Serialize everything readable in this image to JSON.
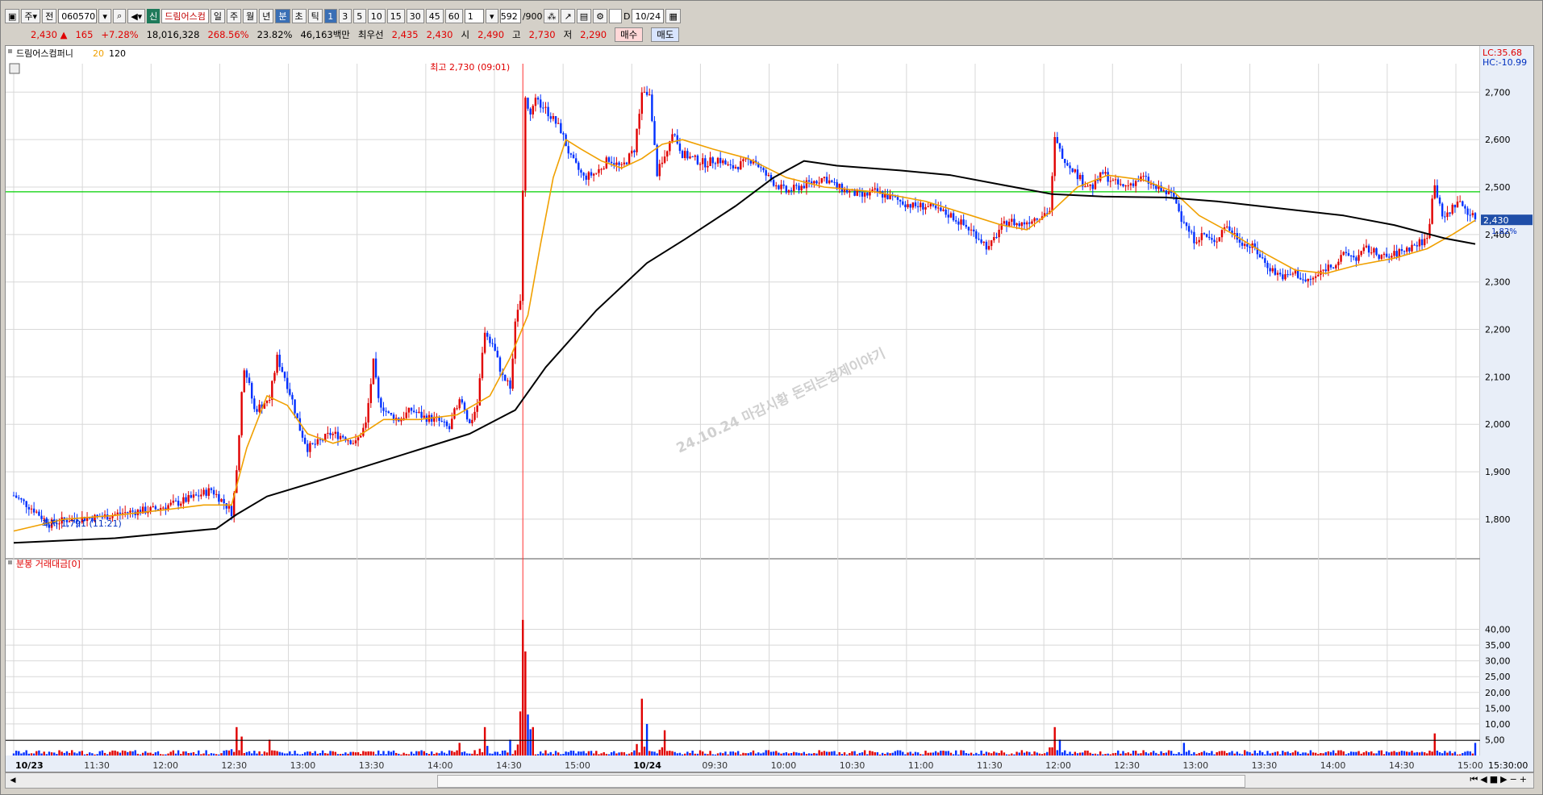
{
  "toolbar": {
    "market": "주",
    "prefix": "전",
    "code": "060570",
    "credit_tag": "신",
    "name": "드림어스컴",
    "periods": [
      "일",
      "주",
      "월",
      "년",
      "분",
      "초",
      "틱"
    ],
    "active_period": "분",
    "intervals": [
      "1",
      "3",
      "5",
      "10",
      "15",
      "30",
      "45",
      "60"
    ],
    "active_interval": "1",
    "unit": "1",
    "count": "592",
    "count_total": "/900",
    "d_label": "D",
    "date": "10/24"
  },
  "quote": {
    "price": "2,430",
    "arrow": "▲",
    "change": "165",
    "change_pct": "+7.28%",
    "volume": "18,016,328",
    "vol_ratio": "268.56%",
    "turnover": "23.82%",
    "amount": "46,163백만",
    "best_label": "최우선",
    "best_ask": "2,435",
    "best_bid": "2,430",
    "open_label": "시",
    "open": "2,490",
    "high_label": "고",
    "high": "2,730",
    "low_label": "저",
    "low": "2,290",
    "buy_label": "매수",
    "sell_label": "매도"
  },
  "legend": {
    "name": "드림어스컴퍼니",
    "ma1": "20",
    "ma2": "120",
    "lc": "LC:35.68",
    "hc": "HC:-10.99",
    "price_tag": "2,430",
    "pct_tag": "1.82%",
    "volume_title": "분봉 거래대금[0]",
    "high_note": "최고 2,730 (09:01)",
    "low_note": "최저 1,791 (11:21)",
    "watermark": "24.10.24 마감시황 돈되는경제이야기",
    "end_time": "15:30:00"
  },
  "colors": {
    "up": "#e00000",
    "down": "#0030ff",
    "ma20": "#f0a000",
    "ma120": "#000000",
    "hline": "#00d000",
    "grid": "#d8d8d8"
  },
  "chart_data": [
    {
      "type": "candlestick",
      "title": "드림어스컴퍼니",
      "ylim": [
        1720,
        2760
      ],
      "yticks": [
        1800,
        1900,
        2000,
        2100,
        2200,
        2300,
        2400,
        2500,
        2600,
        2700
      ],
      "ytick_labels": [
        "1,800",
        "1,900",
        "2,000",
        "2,100",
        "2,200",
        "2,300",
        "2,400",
        "2,500",
        "2,600",
        "2,700"
      ],
      "horizontal_line": 2490,
      "x_labels": [
        "10/23",
        "11:30",
        "12:00",
        "12:30",
        "13:00",
        "13:30",
        "14:00",
        "14:30",
        "15:00",
        "10/24",
        "09:30",
        "10:00",
        "10:30",
        "11:00",
        "11:30",
        "12:00",
        "12:30",
        "13:00",
        "13:30",
        "14:00",
        "14:30",
        "15:00"
      ],
      "price_path": [
        [
          0,
          1850
        ],
        [
          8,
          1820
        ],
        [
          14,
          1790
        ],
        [
          22,
          1800
        ],
        [
          35,
          1805
        ],
        [
          45,
          1815
        ],
        [
          55,
          1820
        ],
        [
          65,
          1835
        ],
        [
          72,
          1848
        ],
        [
          78,
          1862
        ],
        [
          83,
          1835
        ],
        [
          86,
          1815
        ],
        [
          88,
          1900
        ],
        [
          90,
          2060
        ],
        [
          91,
          2120
        ],
        [
          93,
          2080
        ],
        [
          95,
          2030
        ],
        [
          98,
          2040
        ],
        [
          101,
          2060
        ],
        [
          104,
          2140
        ],
        [
          107,
          2100
        ],
        [
          110,
          2050
        ],
        [
          113,
          1990
        ],
        [
          116,
          1950
        ],
        [
          120,
          1960
        ],
        [
          125,
          1980
        ],
        [
          130,
          1975
        ],
        [
          135,
          1960
        ],
        [
          139,
          2000
        ],
        [
          142,
          2130
        ],
        [
          144,
          2050
        ],
        [
          148,
          2020
        ],
        [
          152,
          2010
        ],
        [
          157,
          2030
        ],
        [
          162,
          2015
        ],
        [
          167,
          2010
        ],
        [
          172,
          1990
        ],
        [
          176,
          2060
        ],
        [
          180,
          2000
        ],
        [
          183,
          2040
        ],
        [
          186,
          2200
        ],
        [
          189,
          2170
        ],
        [
          193,
          2100
        ],
        [
          196,
          2080
        ],
        [
          198,
          2210
        ],
        [
          200,
          2260
        ],
        [
          201,
          2500
        ],
        [
          202,
          2680
        ],
        [
          204,
          2650
        ],
        [
          206,
          2680
        ],
        [
          209,
          2670
        ],
        [
          212,
          2650
        ],
        [
          216,
          2620
        ],
        [
          220,
          2560
        ],
        [
          225,
          2520
        ],
        [
          230,
          2530
        ],
        [
          235,
          2560
        ],
        [
          240,
          2540
        ],
        [
          245,
          2580
        ],
        [
          248,
          2700
        ],
        [
          251,
          2690
        ],
        [
          254,
          2530
        ],
        [
          257,
          2560
        ],
        [
          260,
          2620
        ],
        [
          264,
          2570
        ],
        [
          268,
          2560
        ],
        [
          273,
          2550
        ],
        [
          278,
          2560
        ],
        [
          283,
          2540
        ],
        [
          288,
          2550
        ],
        [
          292,
          2560
        ],
        [
          296,
          2530
        ],
        [
          300,
          2510
        ],
        [
          305,
          2490
        ],
        [
          310,
          2500
        ],
        [
          315,
          2510
        ],
        [
          320,
          2520
        ],
        [
          325,
          2500
        ],
        [
          330,
          2490
        ],
        [
          335,
          2480
        ],
        [
          340,
          2490
        ],
        [
          345,
          2480
        ],
        [
          350,
          2470
        ],
        [
          355,
          2460
        ],
        [
          360,
          2460
        ],
        [
          365,
          2450
        ],
        [
          370,
          2440
        ],
        [
          375,
          2420
        ],
        [
          380,
          2400
        ],
        [
          385,
          2370
        ],
        [
          389,
          2410
        ],
        [
          393,
          2430
        ],
        [
          397,
          2420
        ],
        [
          401,
          2430
        ],
        [
          405,
          2440
        ],
        [
          409,
          2450
        ],
        [
          411,
          2600
        ],
        [
          414,
          2560
        ],
        [
          418,
          2540
        ],
        [
          422,
          2510
        ],
        [
          426,
          2500
        ],
        [
          430,
          2530
        ],
        [
          434,
          2510
        ],
        [
          438,
          2500
        ],
        [
          442,
          2510
        ],
        [
          446,
          2520
        ],
        [
          450,
          2500
        ],
        [
          454,
          2490
        ],
        [
          458,
          2480
        ],
        [
          462,
          2420
        ],
        [
          466,
          2390
        ],
        [
          470,
          2400
        ],
        [
          474,
          2380
        ],
        [
          478,
          2420
        ],
        [
          482,
          2400
        ],
        [
          486,
          2380
        ],
        [
          490,
          2370
        ],
        [
          494,
          2340
        ],
        [
          498,
          2320
        ],
        [
          502,
          2310
        ],
        [
          506,
          2320
        ],
        [
          510,
          2300
        ],
        [
          514,
          2310
        ],
        [
          518,
          2330
        ],
        [
          522,
          2340
        ],
        [
          526,
          2360
        ],
        [
          530,
          2350
        ],
        [
          534,
          2370
        ],
        [
          538,
          2360
        ],
        [
          542,
          2350
        ],
        [
          546,
          2360
        ],
        [
          550,
          2370
        ],
        [
          554,
          2380
        ],
        [
          558,
          2390
        ],
        [
          561,
          2510
        ],
        [
          564,
          2430
        ],
        [
          567,
          2450
        ],
        [
          570,
          2470
        ],
        [
          574,
          2450
        ],
        [
          577,
          2430
        ]
      ],
      "ma20_path": [
        [
          0,
          1775
        ],
        [
          20,
          1800
        ],
        [
          40,
          1808
        ],
        [
          60,
          1820
        ],
        [
          75,
          1830
        ],
        [
          86,
          1830
        ],
        [
          92,
          1950
        ],
        [
          100,
          2060
        ],
        [
          108,
          2040
        ],
        [
          116,
          1980
        ],
        [
          126,
          1960
        ],
        [
          136,
          1975
        ],
        [
          146,
          2010
        ],
        [
          160,
          2010
        ],
        [
          175,
          2020
        ],
        [
          188,
          2060
        ],
        [
          196,
          2140
        ],
        [
          203,
          2230
        ],
        [
          208,
          2380
        ],
        [
          213,
          2520
        ],
        [
          218,
          2600
        ],
        [
          224,
          2580
        ],
        [
          232,
          2555
        ],
        [
          240,
          2540
        ],
        [
          248,
          2560
        ],
        [
          256,
          2590
        ],
        [
          264,
          2600
        ],
        [
          276,
          2580
        ],
        [
          290,
          2560
        ],
        [
          305,
          2520
        ],
        [
          320,
          2500
        ],
        [
          340,
          2490
        ],
        [
          360,
          2470
        ],
        [
          378,
          2440
        ],
        [
          390,
          2420
        ],
        [
          400,
          2410
        ],
        [
          410,
          2450
        ],
        [
          420,
          2500
        ],
        [
          432,
          2525
        ],
        [
          446,
          2515
        ],
        [
          458,
          2490
        ],
        [
          468,
          2440
        ],
        [
          480,
          2405
        ],
        [
          494,
          2360
        ],
        [
          506,
          2325
        ],
        [
          518,
          2318
        ],
        [
          530,
          2335
        ],
        [
          545,
          2350
        ],
        [
          558,
          2370
        ],
        [
          568,
          2400
        ],
        [
          577,
          2430
        ]
      ],
      "ma120_path": [
        [
          0,
          1750
        ],
        [
          40,
          1760
        ],
        [
          80,
          1780
        ],
        [
          88,
          1810
        ],
        [
          100,
          1848
        ],
        [
          120,
          1880
        ],
        [
          150,
          1930
        ],
        [
          180,
          1980
        ],
        [
          198,
          2030
        ],
        [
          210,
          2120
        ],
        [
          230,
          2240
        ],
        [
          250,
          2340
        ],
        [
          265,
          2390
        ],
        [
          285,
          2460
        ],
        [
          300,
          2520
        ],
        [
          312,
          2555
        ],
        [
          325,
          2545
        ],
        [
          350,
          2535
        ],
        [
          370,
          2525
        ],
        [
          390,
          2505
        ],
        [
          410,
          2485
        ],
        [
          430,
          2480
        ],
        [
          455,
          2478
        ],
        [
          475,
          2470
        ],
        [
          500,
          2455
        ],
        [
          525,
          2440
        ],
        [
          545,
          2420
        ],
        [
          565,
          2392
        ],
        [
          577,
          2380
        ]
      ]
    },
    {
      "type": "bar",
      "title": "분봉 거래대금[0]",
      "ylim": [
        0,
        45
      ],
      "yticks": [
        5,
        10,
        15,
        20,
        25,
        30,
        35,
        40
      ],
      "ytick_labels": [
        "5,00",
        "10,00",
        "15,00",
        "20,00",
        "25,00",
        "30,00",
        "35,00",
        "40,00"
      ],
      "reference_line": 4.8,
      "peaks": [
        [
          88,
          9
        ],
        [
          90,
          6
        ],
        [
          101,
          5
        ],
        [
          176,
          4
        ],
        [
          186,
          9
        ],
        [
          196,
          5
        ],
        [
          201,
          43
        ],
        [
          202,
          33
        ],
        [
          203,
          13
        ],
        [
          205,
          9
        ],
        [
          248,
          18
        ],
        [
          250,
          10
        ],
        [
          257,
          8
        ],
        [
          411,
          9
        ],
        [
          413,
          5
        ],
        [
          462,
          4
        ],
        [
          561,
          7
        ],
        [
          577,
          4
        ]
      ]
    }
  ]
}
